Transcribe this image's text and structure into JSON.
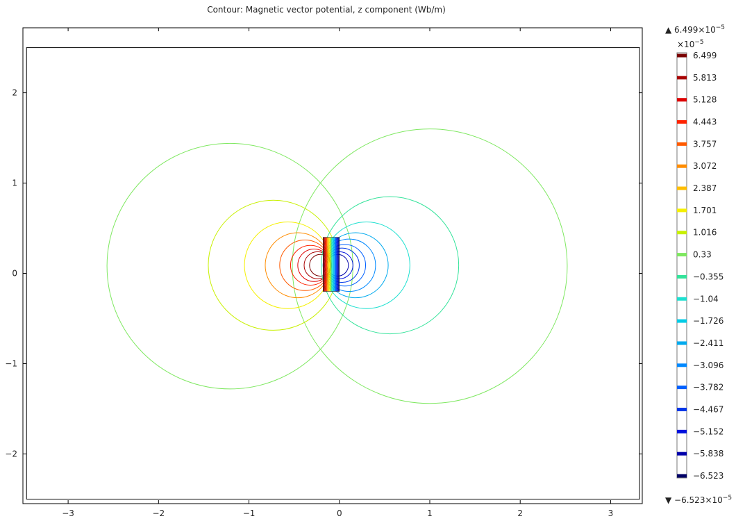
{
  "chart_data": {
    "type": "contour",
    "title": "Contour: Magnetic vector potential, z component (Wb/m)",
    "xlabel": "",
    "ylabel": "",
    "xlim": [
      -3.5,
      3.35
    ],
    "ylim": [
      -2.55,
      2.72
    ],
    "grid": false,
    "x_ticks": [
      -3,
      -2,
      -1,
      0,
      1,
      2,
      3
    ],
    "x_tick_labels": [
      "−3",
      "−2",
      "−1",
      "0",
      "1",
      "2",
      "3"
    ],
    "y_ticks": [
      -2,
      -1,
      0,
      1,
      2
    ],
    "y_tick_labels": [
      "−2",
      "−1",
      "0",
      "1",
      "2"
    ],
    "geometry": {
      "domain_rect": {
        "x0": -3.46,
        "x1": 3.32,
        "y0": -2.5,
        "y1": 2.5
      },
      "magnet_rect": {
        "x0": -0.18,
        "x1": 0.0,
        "y0": -0.2,
        "y1": 0.4
      },
      "dipole_center": [
        -0.09,
        0.1
      ]
    },
    "contour_levels": [
      {
        "value": 6.499,
        "label": "6.499",
        "color": "#7a0000"
      },
      {
        "value": 5.813,
        "label": "5.813",
        "color": "#a80000"
      },
      {
        "value": 5.128,
        "label": "5.128",
        "color": "#dd0000"
      },
      {
        "value": 4.443,
        "label": "4.443",
        "color": "#ff2200"
      },
      {
        "value": 3.757,
        "label": "3.757",
        "color": "#ff5a00"
      },
      {
        "value": 3.072,
        "label": "3.072",
        "color": "#ff8c00"
      },
      {
        "value": 2.387,
        "label": "2.387",
        "color": "#ffbe00"
      },
      {
        "value": 1.701,
        "label": "1.701",
        "color": "#f5f000"
      },
      {
        "value": 1.016,
        "label": "1.016",
        "color": "#c8f000"
      },
      {
        "value": 0.33,
        "label": "0.33",
        "color": "#7ee860"
      },
      {
        "value": -0.355,
        "label": "−0.355",
        "color": "#33e39a"
      },
      {
        "value": -1.04,
        "label": "−1.04",
        "color": "#1ee0d0"
      },
      {
        "value": -1.726,
        "label": "−1.726",
        "color": "#00cce6"
      },
      {
        "value": -2.411,
        "label": "−2.411",
        "color": "#00aaee"
      },
      {
        "value": -3.096,
        "label": "−3.096",
        "color": "#0088ff"
      },
      {
        "value": -3.782,
        "label": "−3.782",
        "color": "#0060ff"
      },
      {
        "value": -4.467,
        "label": "−4.467",
        "color": "#0036e8"
      },
      {
        "value": -5.152,
        "label": "−5.152",
        "color": "#0010dd"
      },
      {
        "value": -5.838,
        "label": "−5.838",
        "color": "#0000aa"
      },
      {
        "value": -6.523,
        "label": "−6.523",
        "color": "#000066"
      }
    ],
    "colorbar": {
      "max_label": "▲ 6.499×10",
      "max_exp": "−5",
      "min_label": "▼ −6.523×10",
      "min_exp": "−5",
      "scale_label": "×10",
      "scale_exp": "−5"
    },
    "contour_curves": [
      {
        "color": "#7ee860",
        "circles": [
          [
            -1.21,
            0.08,
            1.36
          ],
          [
            1.0,
            0.08,
            1.52
          ]
        ]
      },
      {
        "color": "#c8f000",
        "circles": [
          [
            -0.73,
            0.09,
            0.72
          ]
        ]
      },
      {
        "color": "#f5f000",
        "circles": [
          [
            -0.57,
            0.09,
            0.48
          ]
        ]
      },
      {
        "color": "#ff8c00",
        "circles": [
          [
            -0.46,
            0.09,
            0.36
          ]
        ]
      },
      {
        "color": "#ff5a00",
        "circles": [
          [
            -0.38,
            0.09,
            0.28
          ]
        ]
      },
      {
        "color": "#ff2200",
        "circles": [
          [
            -0.32,
            0.09,
            0.22
          ]
        ]
      },
      {
        "color": "#dd0000",
        "circles": [
          [
            -0.28,
            0.09,
            0.18
          ]
        ]
      },
      {
        "color": "#a80000",
        "circles": [
          [
            -0.24,
            0.09,
            0.15
          ]
        ]
      },
      {
        "color": "#7a0000",
        "circles": [
          [
            -0.21,
            0.09,
            0.12
          ]
        ]
      },
      {
        "color": "#33e39a",
        "circles": [
          [
            0.56,
            0.09,
            0.76
          ]
        ]
      },
      {
        "color": "#1ee0d0",
        "circles": [
          [
            0.3,
            0.09,
            0.48
          ]
        ]
      },
      {
        "color": "#00aaee",
        "circles": [
          [
            0.18,
            0.09,
            0.36
          ]
        ]
      },
      {
        "color": "#0088ff",
        "circles": [
          [
            0.11,
            0.09,
            0.29
          ]
        ]
      },
      {
        "color": "#0060ff",
        "circles": [
          [
            0.06,
            0.09,
            0.23
          ]
        ]
      },
      {
        "color": "#0036e8",
        "circles": [
          [
            0.03,
            0.09,
            0.19
          ]
        ]
      },
      {
        "color": "#0010dd",
        "circles": [
          [
            0.0,
            0.09,
            0.15
          ]
        ]
      },
      {
        "color": "#0000aa",
        "circles": [
          [
            -0.02,
            0.09,
            0.12
          ]
        ]
      }
    ]
  }
}
